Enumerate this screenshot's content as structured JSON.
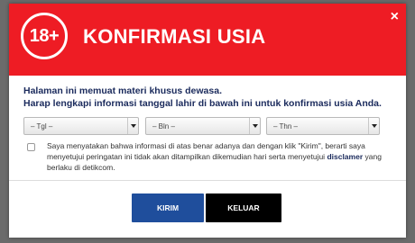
{
  "header": {
    "badge": "18+",
    "title": "KONFIRMASI USIA",
    "close": "×"
  },
  "intro": {
    "line1": "Halaman ini memuat materi khusus dewasa.",
    "line2": "Harap lengkapi informasi tanggal lahir di bawah ini untuk konfirmasi usia Anda."
  },
  "selects": {
    "day": "– Tgl –",
    "month": "– Bln –",
    "year": "– Thn –"
  },
  "consent": {
    "text_before": "Saya menyatakan bahwa informasi di atas benar adanya dan dengan klik \"Kirim\", berarti saya menyetujui peringatan ini tidak akan ditampilkan dikemudian hari serta menyetujui ",
    "link": "disclamer",
    "text_after": " yang berlaku di detikcom."
  },
  "buttons": {
    "submit": "KIRIM",
    "exit": "KELUAR"
  },
  "colors": {
    "header_red": "#ee1c24",
    "intro_text": "#1a2a5c",
    "submit_blue": "#1f4e9c",
    "exit_black": "#000000"
  }
}
